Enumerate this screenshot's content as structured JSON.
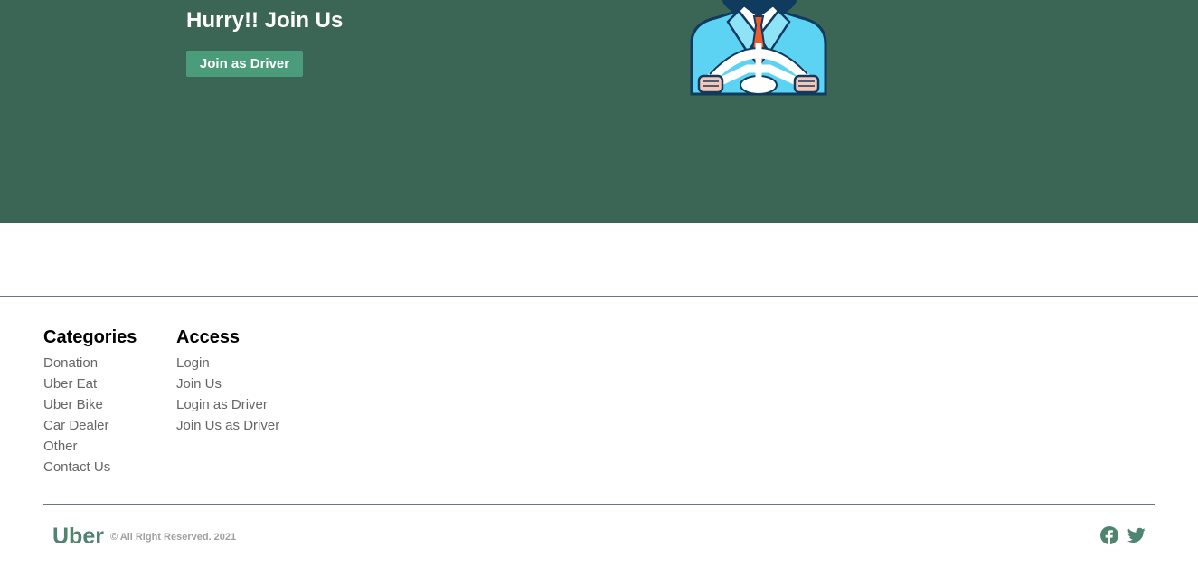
{
  "hero": {
    "title": "Hurry!! Join Us",
    "join_button_label": "Join as Driver",
    "illustration_icon": "driver-steering-wheel-illustration"
  },
  "footer": {
    "categories": {
      "heading": "Categories",
      "items": [
        "Donation",
        "Uber Eat",
        "Uber Bike",
        "Car Dealer",
        "Other",
        "Contact Us"
      ]
    },
    "access": {
      "heading": "Access",
      "items": [
        "Login",
        "Join Us",
        "Login as Driver",
        "Join Us as Driver"
      ]
    },
    "brand": "Uber",
    "copyright": "© All Right Reserved. 2021",
    "social_icons": [
      "facebook-icon",
      "twitter-icon"
    ]
  },
  "colors": {
    "hero_background": "#3b6554",
    "button_background": "#4a9c7a",
    "brand_green": "#4f8470",
    "divider": "#5f7f72",
    "link_gray": "#666666"
  }
}
